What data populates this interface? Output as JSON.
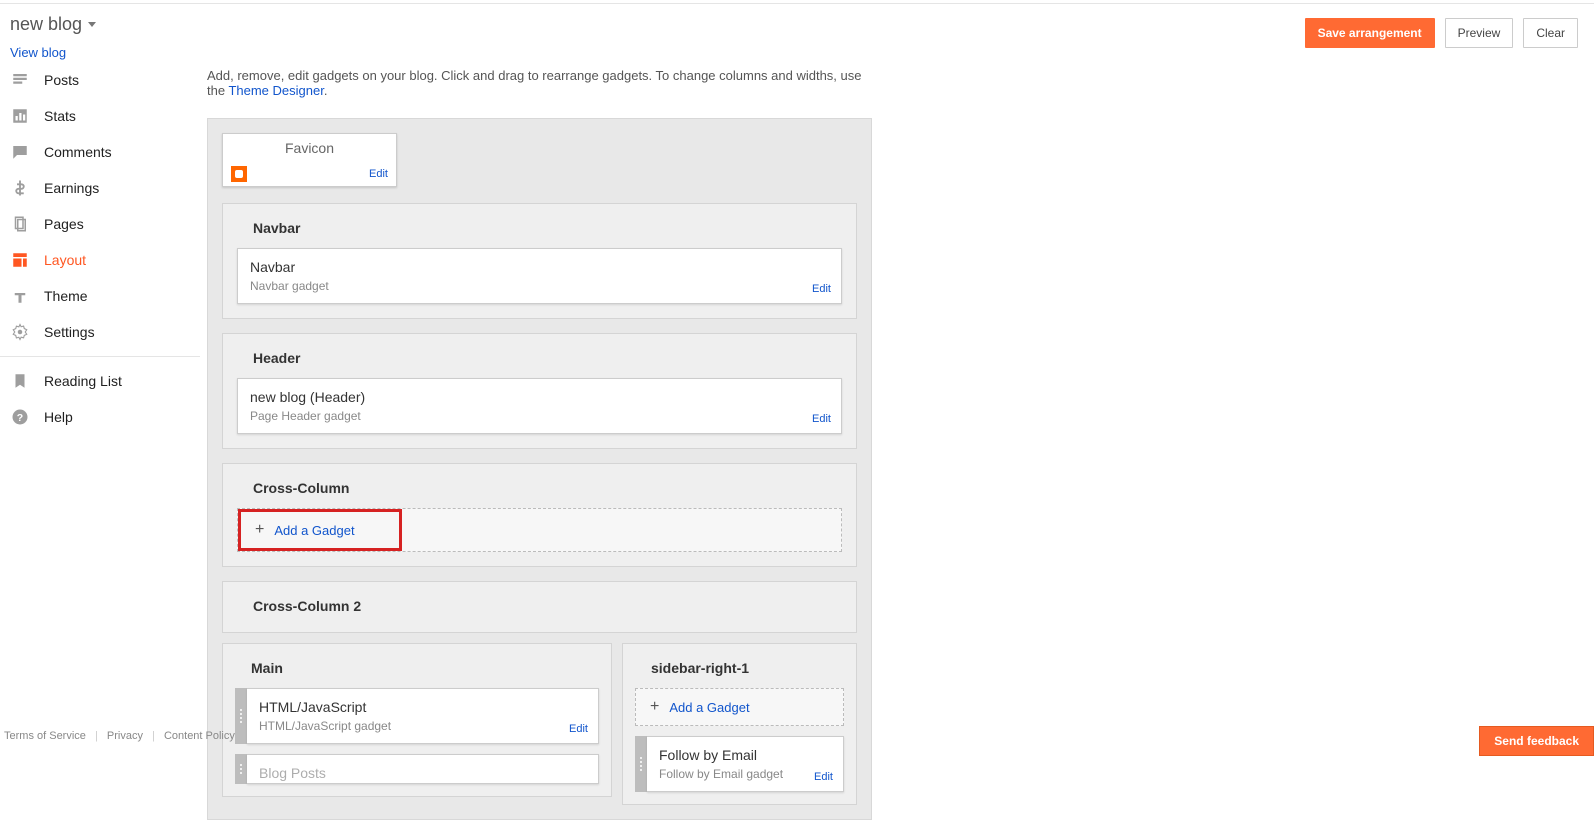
{
  "header": {
    "blog_title": "new blog",
    "view_blog": "View blog"
  },
  "buttons": {
    "save": "Save arrangement",
    "preview": "Preview",
    "clear": "Clear",
    "feedback": "Send feedback"
  },
  "nav": {
    "posts": "Posts",
    "stats": "Stats",
    "comments": "Comments",
    "earnings": "Earnings",
    "pages": "Pages",
    "layout": "Layout",
    "theme": "Theme",
    "settings": "Settings",
    "reading_list": "Reading List",
    "help": "Help"
  },
  "instructions": {
    "text1": "Add, remove, edit gadgets on your blog. Click and drag to rearrange gadgets. To change columns and widths, use the ",
    "link": "Theme Designer",
    "text2": "."
  },
  "favicon": {
    "title": "Favicon",
    "edit": "Edit"
  },
  "sections": {
    "navbar": {
      "title": "Navbar",
      "gadget_name": "Navbar",
      "gadget_sub": "Navbar gadget",
      "edit": "Edit"
    },
    "header": {
      "title": "Header",
      "gadget_name": "new blog (Header)",
      "gadget_sub": "Page Header gadget",
      "edit": "Edit"
    },
    "cross_col": {
      "title": "Cross-Column",
      "add": "Add a Gadget"
    },
    "cross_col2": {
      "title": "Cross-Column 2"
    },
    "main": {
      "title": "Main",
      "html_name": "HTML/JavaScript",
      "html_sub": "HTML/JavaScript gadget",
      "edit": "Edit",
      "blog_posts": "Blog Posts"
    },
    "sidebar_right": {
      "title": "sidebar-right-1",
      "add": "Add a Gadget",
      "follow_name": "Follow by Email",
      "follow_sub": "Follow by Email gadget",
      "edit": "Edit"
    }
  },
  "footer": {
    "terms": "Terms of Service",
    "privacy": "Privacy",
    "content": "Content Policy"
  }
}
